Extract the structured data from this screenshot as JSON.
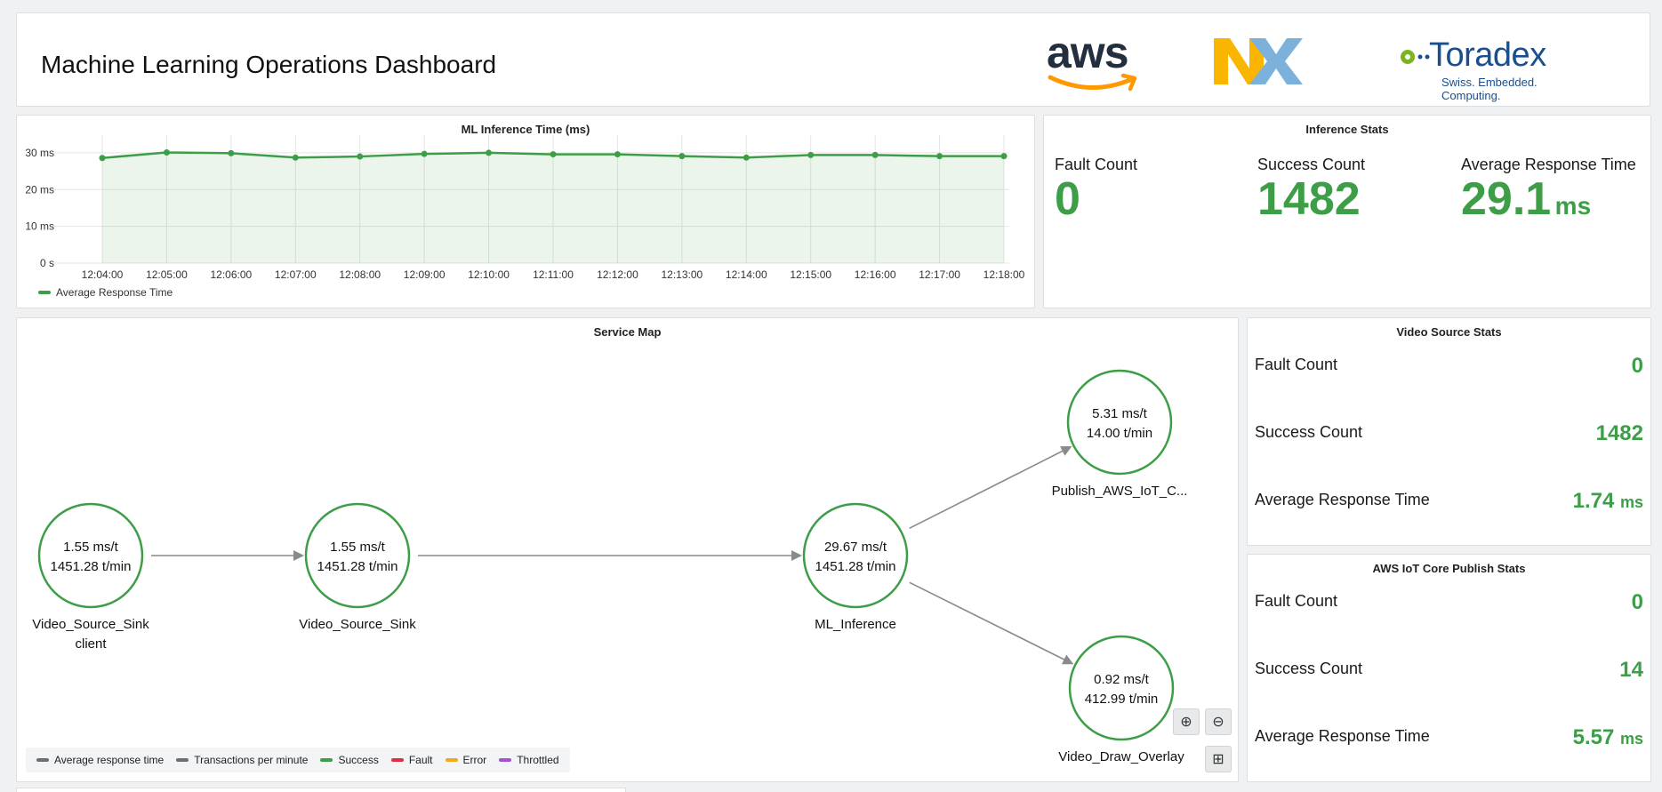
{
  "header": {
    "title": "Machine Learning Operations Dashboard"
  },
  "logos": {
    "aws": {
      "text": "aws",
      "icon": "amazon-smile-icon",
      "color": "#ff9900"
    },
    "nxp": {
      "text": "NXP",
      "colors": [
        "#f9b500",
        "#7bb1db",
        "#c9d200"
      ]
    },
    "toradex": {
      "text": "Toradex",
      "tagline": "Swiss. Embedded. Computing.",
      "color": "#1a4e8f",
      "accent": "#7ab51d"
    }
  },
  "chart_panel": {
    "title": "ML Inference Time (ms)"
  },
  "chart_data": {
    "type": "area",
    "title": "ML Inference Time (ms)",
    "x": [
      "12:04:00",
      "12:05:00",
      "12:06:00",
      "12:07:00",
      "12:08:00",
      "12:09:00",
      "12:10:00",
      "12:11:00",
      "12:12:00",
      "12:13:00",
      "12:14:00",
      "12:15:00",
      "12:16:00",
      "12:17:00",
      "12:18:00"
    ],
    "yticks": [
      "0 s",
      "10 ms",
      "20 ms",
      "30 ms"
    ],
    "ylim": [
      0,
      30
    ],
    "series": [
      {
        "name": "Average Response Time",
        "color": "#3d9e47",
        "values": [
          28.6,
          30.1,
          29.9,
          28.7,
          29.0,
          29.7,
          30.0,
          29.6,
          29.6,
          29.1,
          28.7,
          29.4,
          29.4,
          29.1,
          29.1
        ]
      }
    ],
    "grid": true,
    "legend": "bottom-left"
  },
  "inference_stats": {
    "title": "Inference Stats",
    "fault": {
      "label": "Fault Count",
      "value": "0"
    },
    "success": {
      "label": "Success Count",
      "value": "1482"
    },
    "avg": {
      "label": "Average Response Time",
      "value": "29.1",
      "unit": "ms"
    }
  },
  "service_map": {
    "title": "Service Map",
    "nodes": [
      {
        "id": "client",
        "line1": "1.55 ms/t",
        "line2": "1451.28 t/min",
        "name": "Video_Source_Sink",
        "sub": "client"
      },
      {
        "id": "sink",
        "line1": "1.55 ms/t",
        "line2": "1451.28 t/min",
        "name": "Video_Source_Sink",
        "sub": ""
      },
      {
        "id": "ml",
        "line1": "29.67 ms/t",
        "line2": "1451.28 t/min",
        "name": "ML_Inference",
        "sub": ""
      },
      {
        "id": "publish",
        "line1": "5.31 ms/t",
        "line2": "14.00 t/min",
        "name": "Publish_AWS_IoT_C...",
        "sub": ""
      },
      {
        "id": "draw",
        "line1": "0.92 ms/t",
        "line2": "412.99 t/min",
        "name": "Video_Draw_Overlay",
        "sub": ""
      }
    ],
    "node_color": "#3d9e47",
    "edge_color": "#8a8a8a",
    "legend": [
      {
        "label": "Average response time",
        "color": "#6e6e6e"
      },
      {
        "label": "Transactions per minute",
        "color": "#6e6e6e"
      },
      {
        "label": "Success",
        "color": "#3d9e47"
      },
      {
        "label": "Fault",
        "color": "#e02f44"
      },
      {
        "label": "Error",
        "color": "#f2a81d"
      },
      {
        "label": "Throttled",
        "color": "#a352cc"
      }
    ],
    "controls": {
      "zoom_in": "⊕",
      "zoom_out": "⊖",
      "fit": "⊞"
    }
  },
  "video_stats": {
    "title": "Video Source Stats",
    "fault": {
      "label": "Fault Count",
      "value": "0"
    },
    "success": {
      "label": "Success Count",
      "value": "1482"
    },
    "avg": {
      "label": "Average Response Time",
      "value": "1.74",
      "unit": "ms"
    }
  },
  "iot_stats": {
    "title": "AWS IoT Core Publish Stats",
    "fault": {
      "label": "Fault Count",
      "value": "0"
    },
    "success": {
      "label": "Success Count",
      "value": "14"
    },
    "avg": {
      "label": "Average Response Time",
      "value": "5.57",
      "unit": "ms"
    }
  }
}
